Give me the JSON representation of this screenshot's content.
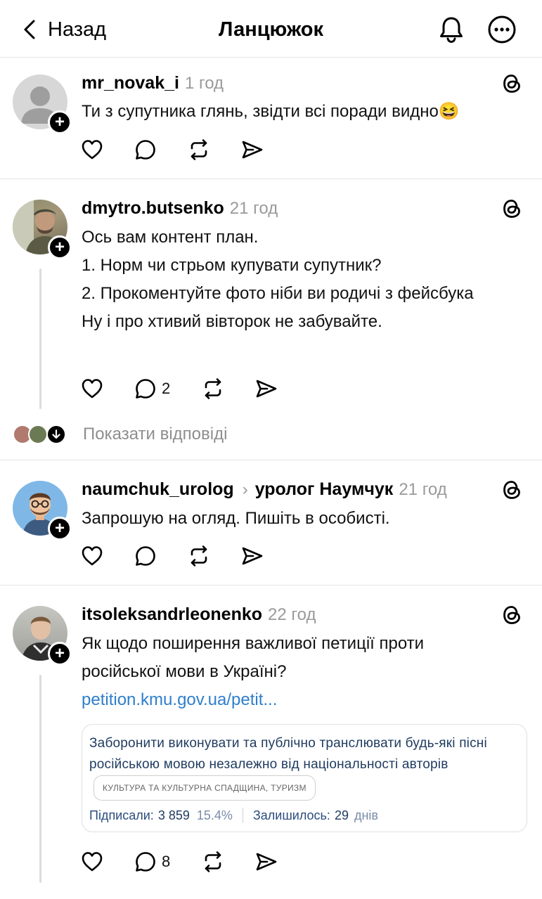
{
  "header": {
    "back_label": "Назад",
    "title": "Ланцюжок"
  },
  "icons": {
    "back": "chevron-left-icon",
    "notifications": "bell-icon",
    "more": "more-options-icon",
    "threads": "threads-logo-icon",
    "like": "heart-icon",
    "reply": "comment-icon",
    "repost": "repost-icon",
    "share": "send-icon"
  },
  "posts": [
    {
      "username": "mr_novak_i",
      "time": "1 год",
      "lines": [
        "Ти з супутника глянь, звідти всі поради видно😆"
      ],
      "reply_count": ""
    },
    {
      "username": "dmytro.butsenko",
      "time": "21 год",
      "lines": [
        "Ось вам контент план.",
        "1. Норм чи стрьом купувати супутник?",
        "2. Прокоментуйте фото ніби ви родичі з фейсбука",
        "Ну і про хтивий вівторок не забувайте."
      ],
      "reply_count": "2",
      "show_replies_label": "Показати відповіді"
    },
    {
      "username": "naumchuk_urolog",
      "reply_to": "уролог Наумчук",
      "time": "21 год",
      "lines": [
        "Запрошую на огляд. Пишіть в особисті."
      ],
      "reply_count": ""
    },
    {
      "username": "itsoleksandrleonenko",
      "time": "22 год",
      "lines": [
        "Як щодо поширення важливої петиції проти російської мови в Україні?"
      ],
      "link": "petition.kmu.gov.ua/petit...",
      "reply_count": "8",
      "card": {
        "title": "Заборонити виконувати та публічно транслювати будь-які пісні російською мовою незалежно від національності авторів",
        "tag": "КУЛЬТУРА ТА КУЛЬТУРНА СПАДЩИНА, ТУРИЗМ",
        "signed_label": "Підписали:",
        "signed_value": "3 859",
        "percent": "15.4%",
        "remaining_label": "Залишилось:",
        "remaining_value": "29",
        "remaining_unit": "днів"
      }
    }
  ],
  "colors": {
    "link": "#2f7fcc",
    "muted": "#9a9a9a",
    "separator": "#e3e3e3"
  }
}
